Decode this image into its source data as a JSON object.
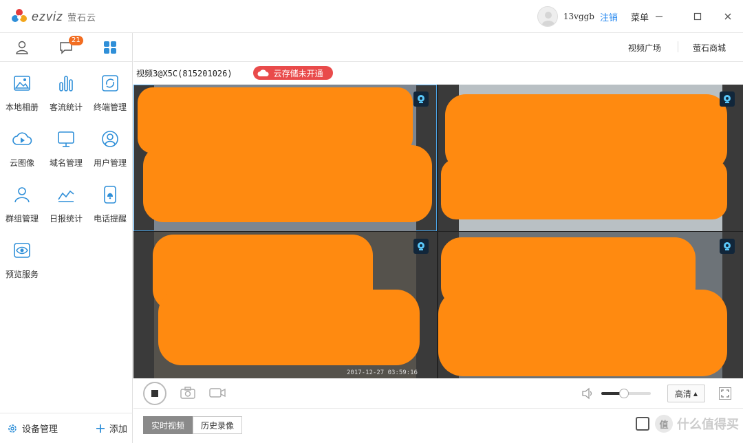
{
  "app": {
    "brand_latin": "ezviz",
    "brand_cn": "萤石云"
  },
  "titlebar": {
    "username": "13vggb",
    "logout_label": "注销",
    "menu_label": "菜单"
  },
  "sidebar": {
    "message_badge": "21",
    "items": [
      {
        "label": "本地相册",
        "icon": "photo-icon"
      },
      {
        "label": "客流统计",
        "icon": "bar-chart-icon"
      },
      {
        "label": "终端管理",
        "icon": "sync-icon"
      },
      {
        "label": "云图像",
        "icon": "cloud-play-icon"
      },
      {
        "label": "域名管理",
        "icon": "monitor-icon"
      },
      {
        "label": "用户管理",
        "icon": "user-circle-icon"
      },
      {
        "label": "群组管理",
        "icon": "group-icon"
      },
      {
        "label": "日报统计",
        "icon": "line-chart-icon"
      },
      {
        "label": "电话提醒",
        "icon": "phone-bell-icon"
      },
      {
        "label": "预览服务",
        "icon": "eye-icon"
      }
    ],
    "device_manage_label": "设备管理",
    "add_label": "添加"
  },
  "topnav": {
    "video_square": "视频广场",
    "mall": "萤石商城"
  },
  "video": {
    "title": "视频3@X5C(815201026)",
    "cloud_label": "云存储未开通",
    "timestamp": "2017-12-27 03:59:16"
  },
  "controls": {
    "quality_label": "高清",
    "volume_percent": 46
  },
  "bottom_tabs": {
    "live": "实时视频",
    "history": "历史录像"
  },
  "watermark": {
    "circle_text": "值",
    "text": "什么值得买"
  },
  "colors": {
    "accent_blue": "#2d8cf0",
    "badge_orange": "#f26d21",
    "cloud_red": "#e94b4b",
    "icon_blue": "#2f8fd8"
  }
}
